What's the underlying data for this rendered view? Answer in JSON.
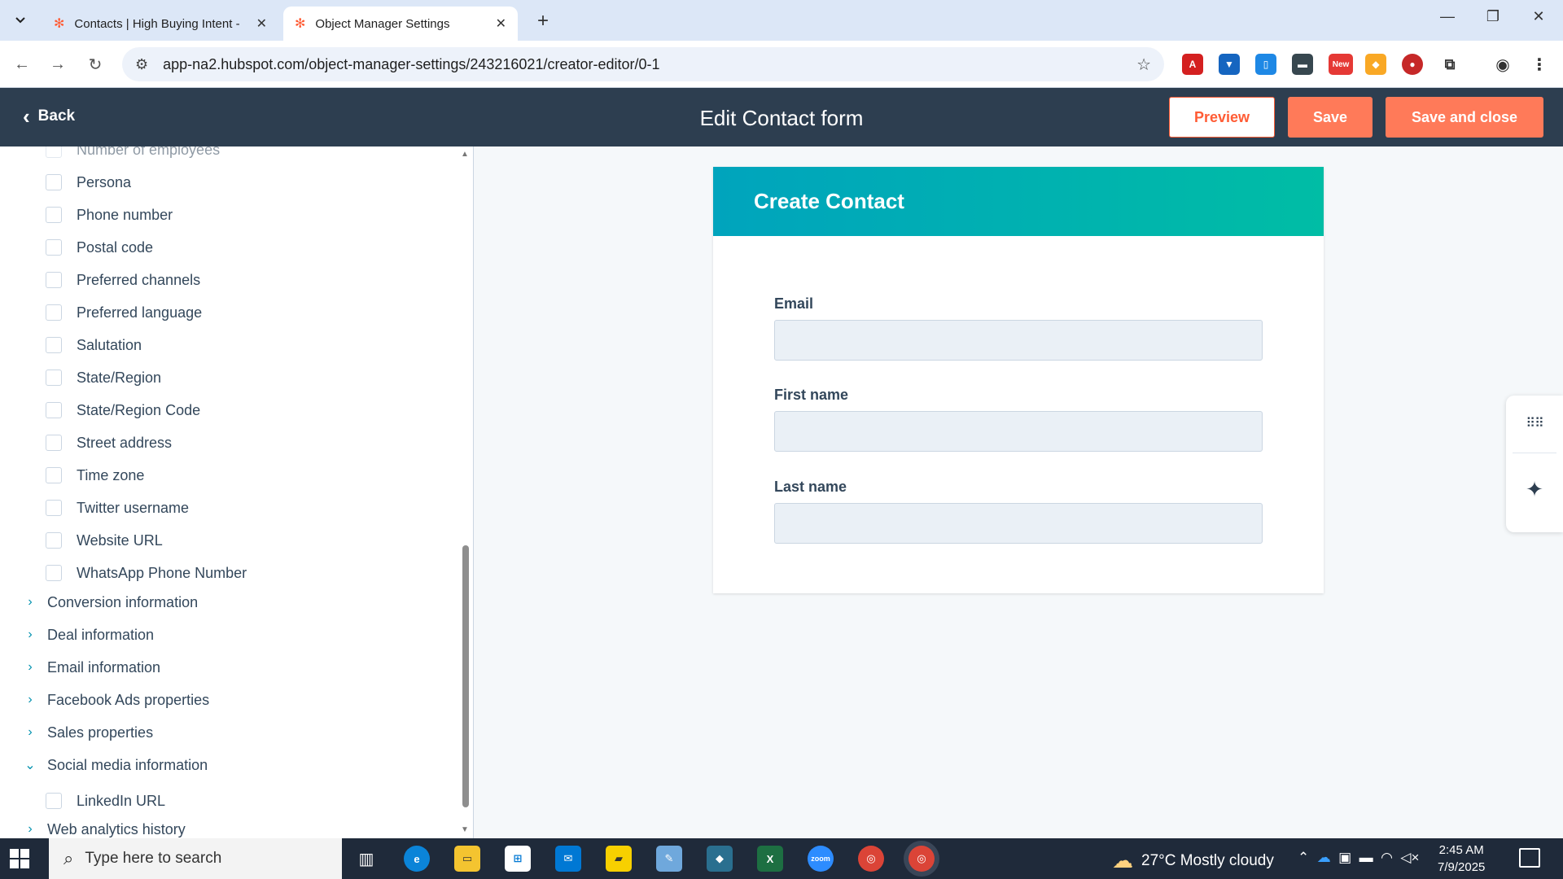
{
  "browser": {
    "tabs": [
      {
        "title": "Contacts | High Buying Intent -",
        "active": false
      },
      {
        "title": "Object Manager Settings",
        "active": true
      }
    ],
    "url": "app-na2.hubspot.com/object-manager-settings/243216021/creator-editor/0-1",
    "extension_badge": "New"
  },
  "header": {
    "back_label": "Back",
    "title": "Edit Contact form",
    "preview_label": "Preview",
    "save_label": "Save",
    "save_close_label": "Save and close"
  },
  "sidebar": {
    "top_partial": "Number of employees",
    "properties": [
      "Persona",
      "Phone number",
      "Postal code",
      "Preferred channels",
      "Preferred language",
      "Salutation",
      "State/Region",
      "State/Region Code",
      "Street address",
      "Time zone",
      "Twitter username",
      "Website URL",
      "WhatsApp Phone Number"
    ],
    "groups": [
      {
        "label": "Conversion information",
        "expanded": false
      },
      {
        "label": "Deal information",
        "expanded": false
      },
      {
        "label": "Email information",
        "expanded": false
      },
      {
        "label": "Facebook Ads properties",
        "expanded": false
      },
      {
        "label": "Sales properties",
        "expanded": false
      },
      {
        "label": "Social media information",
        "expanded": true
      }
    ],
    "social_properties": [
      "LinkedIn URL"
    ],
    "bottom_group": "Web analytics history"
  },
  "form": {
    "title": "Create Contact",
    "fields": [
      {
        "label": "Email",
        "value": ""
      },
      {
        "label": "First name",
        "value": ""
      },
      {
        "label": "Last name",
        "value": ""
      }
    ]
  },
  "colors": {
    "header_bg": "#2d3e50",
    "accent": "#ff7a59",
    "form_gradient_start": "#00a4bd",
    "form_gradient_end": "#00bda5"
  },
  "taskbar": {
    "search_placeholder": "Type here to search",
    "weather_temp": "27°C",
    "weather_text": "Mostly cloudy",
    "time": "2:45 AM",
    "date": "7/9/2025"
  }
}
